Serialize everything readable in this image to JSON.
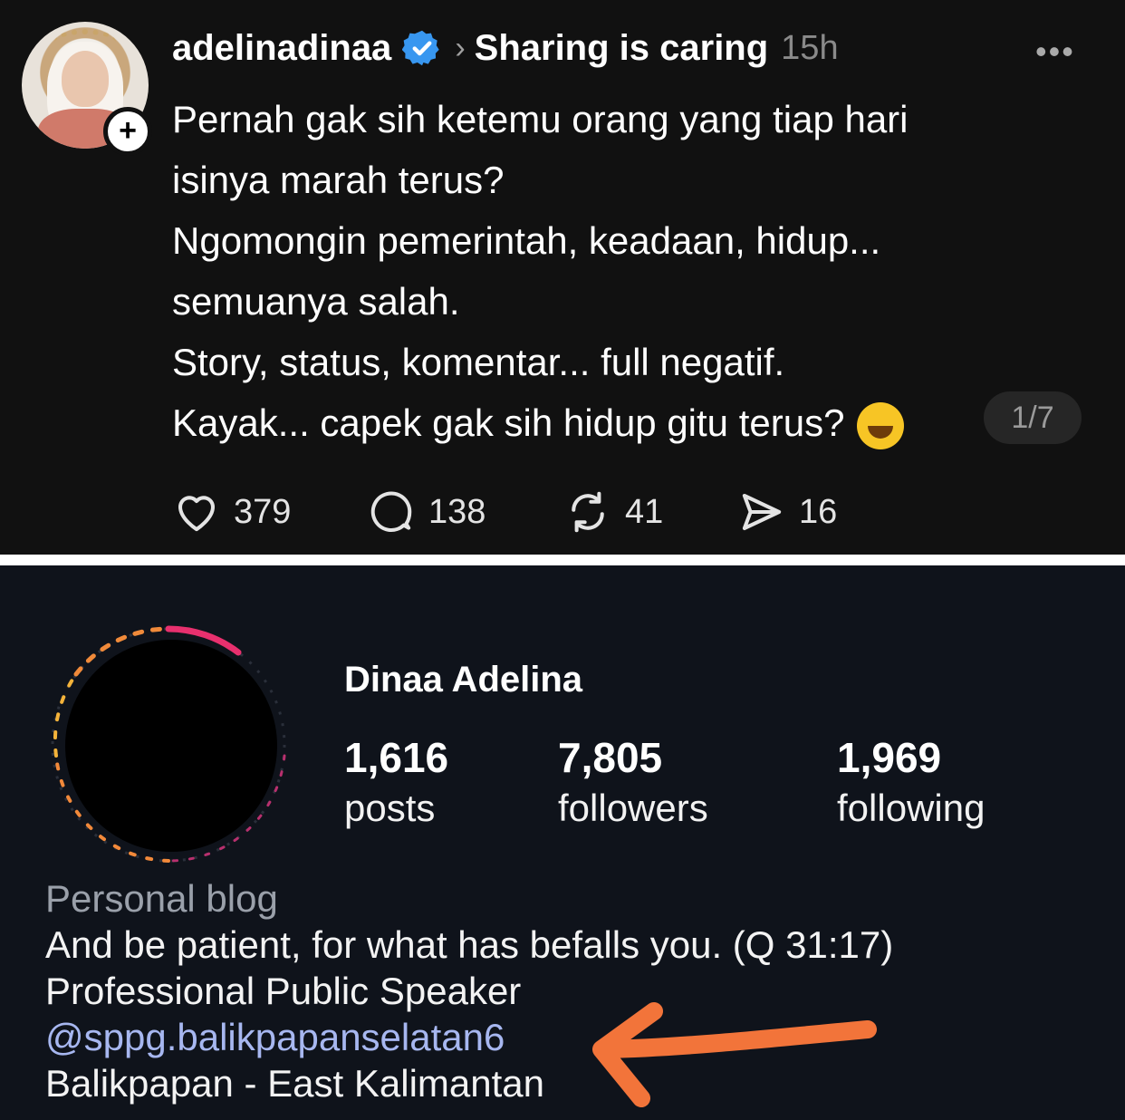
{
  "thread_post": {
    "username": "adelinadinaa",
    "topic": "Sharing is caring",
    "time": "15h",
    "more_label": "•••",
    "lines": [
      "Pernah gak sih ketemu orang yang tiap hari",
      "isinya marah terus?",
      "Ngomongin pemerintah, keadaan, hidup...",
      "semuanya salah.",
      "Story, status, komentar... full negatif.",
      "Kayak... capek gak sih hidup gitu terus?"
    ],
    "emoji_icon": "grinning-sweat-face",
    "pager": "1/7",
    "likes": "379",
    "comments": "138",
    "reposts": "41",
    "shares": "16"
  },
  "profile": {
    "name": "Dinaa Adelina",
    "stats": [
      {
        "value": "1,616",
        "label": "posts"
      },
      {
        "value": "7,805",
        "label": "followers"
      },
      {
        "value": "1,969",
        "label": "following"
      }
    ],
    "bio": {
      "category": "Personal blog",
      "quote": "And be patient, for what has befalls you. (Q 31:17)",
      "occupation": "Professional Public Speaker",
      "threads_link": "@sppg.balikpapanselatan6",
      "location": "Balikpapan - East Kalimantan"
    }
  },
  "colors": {
    "thread_bg": "#111111",
    "profile_bg": "#0f131b",
    "verified_blue": "#3897f0",
    "link_blue": "#a7b7f0",
    "annotation_orange": "#f2743a"
  }
}
